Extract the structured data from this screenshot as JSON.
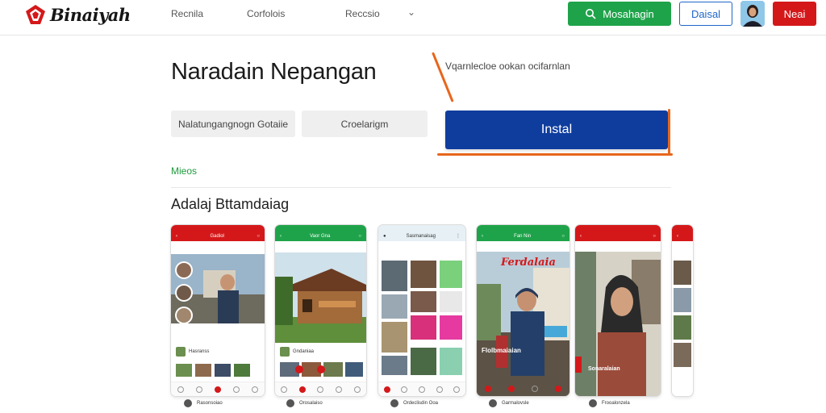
{
  "header": {
    "logo_text": "Binaiyah",
    "nav": [
      "Recnila",
      "Corfolois",
      "Reccsio"
    ],
    "search_button": "Mosahagin",
    "outline_button": "Daisal",
    "red_button": "Neai"
  },
  "hero": {
    "title": "Naradain Nepangan",
    "description": "Vqarnlecloe ookan ocifarnlan",
    "button_1": "Nalatungangnogn Gotaiie",
    "button_2": "Croelarigm",
    "install_button": "Instal",
    "more_link": "Mieos"
  },
  "section": {
    "title": "Adalaj Bttamdaiag"
  },
  "phones": [
    {
      "appbar_title": "Gadiol",
      "row_label": "Hasranss",
      "theme": "#d4181a"
    },
    {
      "appbar_title": "Vaor Gna",
      "row_label": "Gndaniaa",
      "theme": "#1fa34a"
    },
    {
      "appbar_title": "Sasmanaisag",
      "row_label": "",
      "theme": "#e6f0f5"
    },
    {
      "appbar_title": "Fan Nin",
      "overlay_title": "Ferdalaia",
      "overlay_sub": "Flolbmaiaian",
      "row_label": "",
      "theme": "#1fa34a"
    },
    {
      "appbar_title": "",
      "overlay_sub": "Sonaralaian",
      "row_label": "",
      "theme": "#d4181a"
    },
    {
      "appbar_title": "",
      "row_label": "",
      "theme": "#d4181a"
    }
  ],
  "captions": [
    "Rasonsoiao",
    "Orosalaiso",
    "Ordeclisdin Ooa",
    "Garmalovsle",
    "Frooalonzela"
  ],
  "colors": {
    "green": "#1fa34a",
    "red": "#d4181a",
    "blue": "#0f3d9e",
    "orange": "#e8661c"
  }
}
